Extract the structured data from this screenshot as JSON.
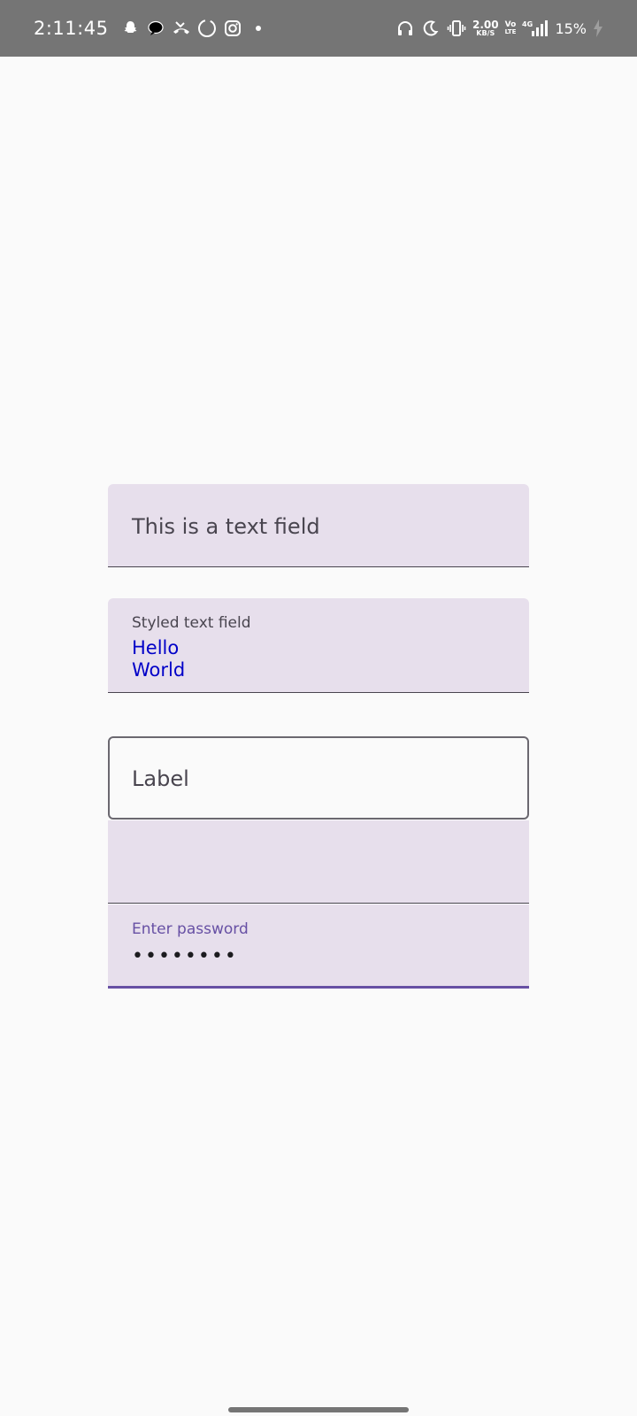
{
  "status_bar": {
    "time": "2:11:45",
    "left_icons": [
      "snapchat-icon",
      "chat-icon",
      "missed-call-icon",
      "loading-circle-icon",
      "instagram-icon",
      "dot-icon"
    ],
    "net_speed_value": "2.00",
    "net_speed_unit": "KB/S",
    "volte_top": "Vo",
    "volte_bottom": "LTE",
    "network": "4G",
    "battery_percent": "15%"
  },
  "fields": {
    "text_field": {
      "placeholder": "This is a text field"
    },
    "styled_field": {
      "label": "Styled text field",
      "value": "Hello\nWorld",
      "value_color": "#0000c8"
    },
    "outlined_field": {
      "label": "Label"
    },
    "empty_field": {
      "value": ""
    },
    "password_field": {
      "label": "Enter password",
      "value": "••••••••",
      "accent_color": "#6750a4"
    }
  },
  "colors": {
    "status_bar_bg": "#757575",
    "background": "#fafafa",
    "field_fill": "#e7dfec",
    "indicator": "#49454f"
  }
}
